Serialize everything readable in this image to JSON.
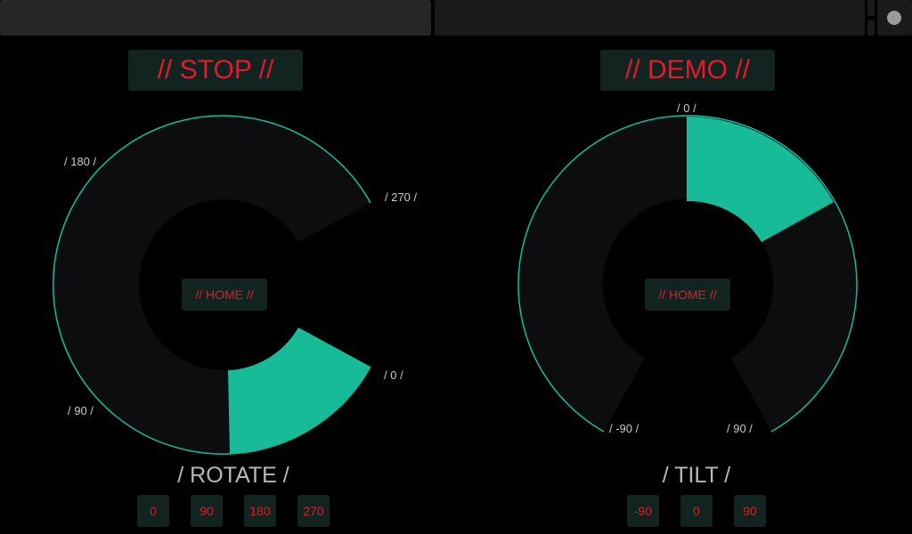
{
  "rotate": {
    "state": "// STOP //",
    "home": "// HOME //",
    "title": "/ ROTATE /",
    "scale": {
      "a0": "/ 0 /",
      "a90": "/ 90 /",
      "a180": "/ 180 /",
      "a270": "/ 270 /"
    },
    "presets": [
      "0",
      "90",
      "180",
      "270"
    ]
  },
  "tilt": {
    "state": "// DEMO //",
    "home": "// HOME //",
    "title": "/ TILT /",
    "scale": {
      "m90": "/ -90 /",
      "z": "/ 0 /",
      "p90": "/ 90 /"
    },
    "presets": [
      "-90",
      "0",
      "90"
    ]
  },
  "colors": {
    "background": "#000000",
    "accent": "#17bb98",
    "text_red": "#e8182a",
    "button_bg": "#12241f",
    "dial_bg": "#0d0d10"
  }
}
